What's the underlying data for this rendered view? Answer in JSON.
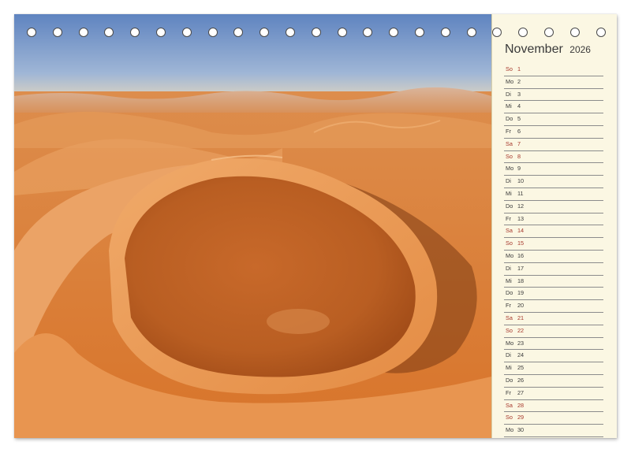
{
  "calendar": {
    "month": "November",
    "year": "2026",
    "days": [
      {
        "dow": "So",
        "day": "1",
        "weekend": true
      },
      {
        "dow": "Mo",
        "day": "2",
        "weekend": false
      },
      {
        "dow": "Di",
        "day": "3",
        "weekend": false
      },
      {
        "dow": "Mi",
        "day": "4",
        "weekend": false
      },
      {
        "dow": "Do",
        "day": "5",
        "weekend": false
      },
      {
        "dow": "Fr",
        "day": "6",
        "weekend": false
      },
      {
        "dow": "Sa",
        "day": "7",
        "weekend": true
      },
      {
        "dow": "So",
        "day": "8",
        "weekend": true
      },
      {
        "dow": "Mo",
        "day": "9",
        "weekend": false
      },
      {
        "dow": "Di",
        "day": "10",
        "weekend": false
      },
      {
        "dow": "Mi",
        "day": "11",
        "weekend": false
      },
      {
        "dow": "Do",
        "day": "12",
        "weekend": false
      },
      {
        "dow": "Fr",
        "day": "13",
        "weekend": false
      },
      {
        "dow": "Sa",
        "day": "14",
        "weekend": true
      },
      {
        "dow": "So",
        "day": "15",
        "weekend": true
      },
      {
        "dow": "Mo",
        "day": "16",
        "weekend": false
      },
      {
        "dow": "Di",
        "day": "17",
        "weekend": false
      },
      {
        "dow": "Mi",
        "day": "18",
        "weekend": false
      },
      {
        "dow": "Do",
        "day": "19",
        "weekend": false
      },
      {
        "dow": "Fr",
        "day": "20",
        "weekend": false
      },
      {
        "dow": "Sa",
        "day": "21",
        "weekend": true
      },
      {
        "dow": "So",
        "day": "22",
        "weekend": true
      },
      {
        "dow": "Mo",
        "day": "23",
        "weekend": false
      },
      {
        "dow": "Di",
        "day": "24",
        "weekend": false
      },
      {
        "dow": "Mi",
        "day": "25",
        "weekend": false
      },
      {
        "dow": "Do",
        "day": "26",
        "weekend": false
      },
      {
        "dow": "Fr",
        "day": "27",
        "weekend": false
      },
      {
        "dow": "Sa",
        "day": "28",
        "weekend": true
      },
      {
        "dow": "So",
        "day": "29",
        "weekend": true
      },
      {
        "dow": "Mo",
        "day": "30",
        "weekend": false
      }
    ]
  },
  "binding_holes": 23,
  "colors": {
    "panel": "#fbf7e3",
    "weekend_text": "#a6362a",
    "weekday_text": "#3a3a3a",
    "sand": "#d97a2e",
    "sky": "#7f9dc8"
  },
  "photo": {
    "icon": "desert-dune-photo"
  }
}
